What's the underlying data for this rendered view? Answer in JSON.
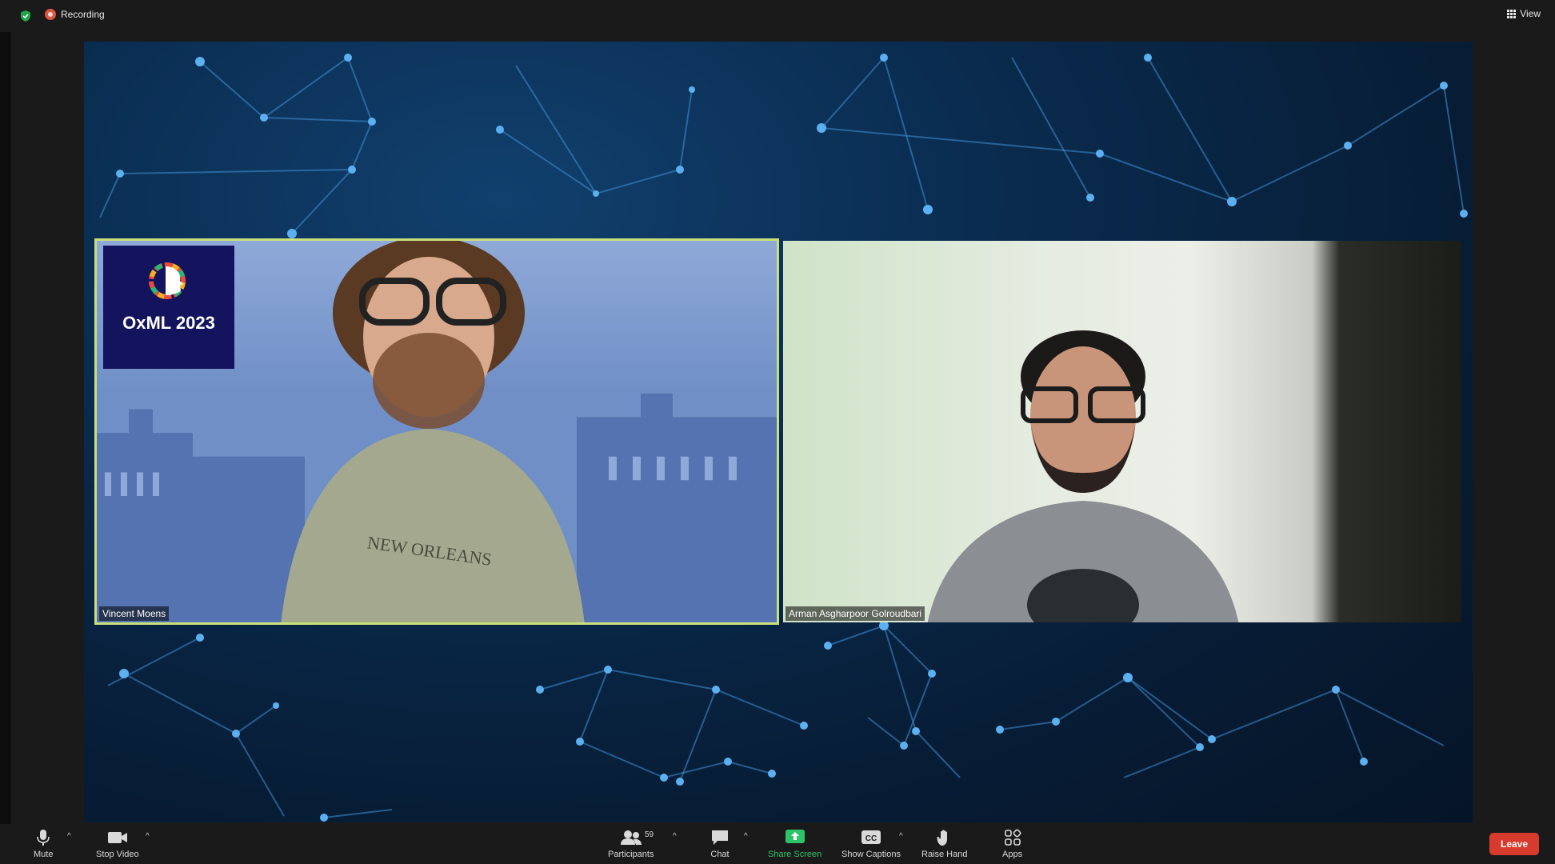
{
  "topbar": {
    "recording_label": "Recording",
    "view_label": "View",
    "shield_icon": "shield-check-icon",
    "recording_icon": "recording-dot-icon"
  },
  "participants": [
    {
      "name": "Vincent Moens",
      "active_speaker": true
    },
    {
      "name": "Arman Asgharpoor Golroudbari",
      "active_speaker": false
    }
  ],
  "overlay": {
    "logo_text": "OxML 2023"
  },
  "toolbar": {
    "mute_label": "Mute",
    "stop_video_label": "Stop Video",
    "participants_label": "Participants",
    "participants_count": "59",
    "chat_label": "Chat",
    "share_screen_label": "Share Screen",
    "show_captions_label": "Show Captions",
    "captions_glyph": "CC",
    "raise_hand_label": "Raise Hand",
    "apps_label": "Apps",
    "leave_label": "Leave",
    "caret": "^"
  },
  "colors": {
    "active_speaker_border": "#c9e07a",
    "share_green": "#2ec36a",
    "leave_red": "#d83b2b",
    "recording_red": "#e0533f"
  }
}
